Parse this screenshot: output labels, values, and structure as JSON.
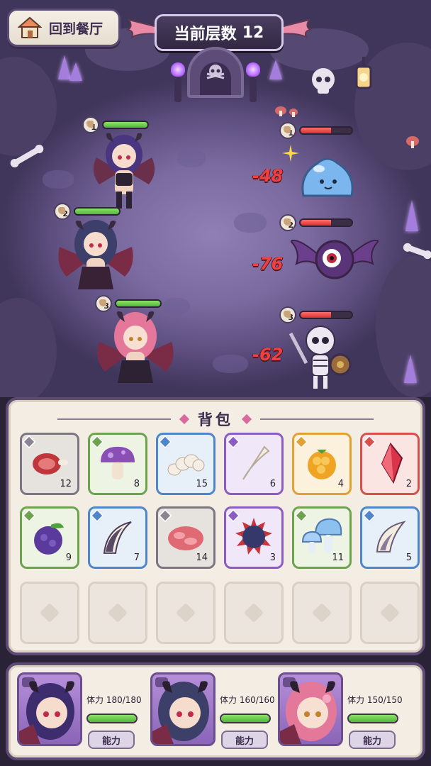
{
  "header": {
    "home_label": "回到餐厅",
    "floor_label": "当前层数",
    "floor_value": "12"
  },
  "heroes": [
    {
      "level": "1",
      "hp_fraction": 1.0
    },
    {
      "level": "2",
      "hp_fraction": 1.0
    },
    {
      "level": "3",
      "hp_fraction": 1.0
    }
  ],
  "enemies": [
    {
      "name": "slime",
      "level": "1",
      "hp_fraction": 0.6,
      "damage": "-48"
    },
    {
      "name": "bat",
      "level": "2",
      "hp_fraction": 0.6,
      "damage": "-76"
    },
    {
      "name": "skeleton",
      "level": "3",
      "hp_fraction": 0.6,
      "damage": "-62"
    }
  ],
  "backpack": {
    "title": "背包",
    "items": [
      {
        "icon": "meat-icon",
        "rarity": "gray",
        "count": "12"
      },
      {
        "icon": "mushroom-icon",
        "rarity": "green",
        "count": "8"
      },
      {
        "icon": "larva-icon",
        "rarity": "blue",
        "count": "15"
      },
      {
        "icon": "fang-icon",
        "rarity": "purple",
        "count": "6"
      },
      {
        "icon": "golden-berry-icon",
        "rarity": "gold",
        "count": "4"
      },
      {
        "icon": "red-crystal-icon",
        "rarity": "red",
        "count": "2"
      },
      {
        "icon": "dark-berry-icon",
        "rarity": "green",
        "count": "9"
      },
      {
        "icon": "claw-icon",
        "rarity": "blue",
        "count": "7"
      },
      {
        "icon": "raw-meat-icon",
        "rarity": "gray",
        "count": "14"
      },
      {
        "icon": "spiked-orb-icon",
        "rarity": "purple",
        "count": "3"
      },
      {
        "icon": "blue-mushroom-icon",
        "rarity": "green",
        "count": "11"
      },
      {
        "icon": "horn-icon",
        "rarity": "blue",
        "count": "5"
      }
    ]
  },
  "party": [
    {
      "stamina_label": "体力 180/180",
      "stamina_fraction": 1.0,
      "ability_label": "能力"
    },
    {
      "stamina_label": "体力 160/160",
      "stamina_fraction": 1.0,
      "ability_label": "能力"
    },
    {
      "stamina_label": "体力 150/150",
      "stamina_fraction": 1.0,
      "ability_label": "能力"
    }
  ],
  "colors": {
    "hp_green": "#4fb83a",
    "hp_red": "#d93030",
    "damage_text": "#f04040",
    "panel_border": "#5d4b74"
  }
}
